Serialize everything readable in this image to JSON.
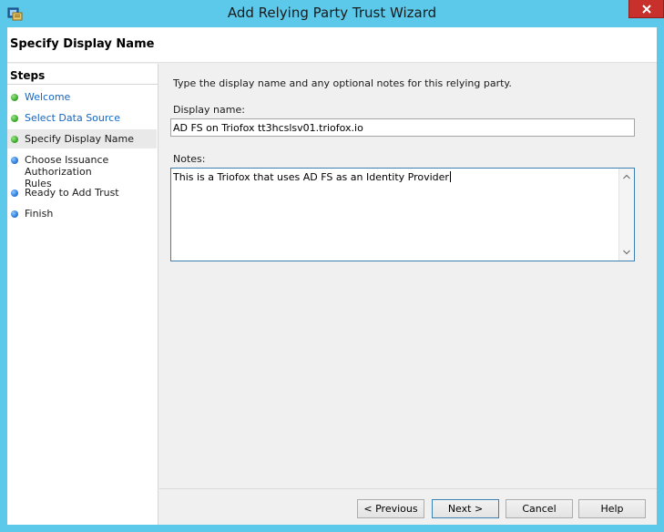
{
  "window": {
    "title": "Add Relying Party Trust Wizard",
    "icon": "adfs-wizard-icon",
    "close_icon": "close-icon",
    "accent": "#5cc8ea",
    "close_color": "#c7302b"
  },
  "header": {
    "title": "Specify Display Name"
  },
  "steps": {
    "title": "Steps",
    "items": [
      {
        "label": "Welcome",
        "status": "completed",
        "link": true
      },
      {
        "label": "Select Data Source",
        "status": "completed",
        "link": true
      },
      {
        "label": "Specify Display Name",
        "status": "current",
        "link": false
      },
      {
        "label": "Choose Issuance Authorization Rules",
        "status": "pending",
        "link": false
      },
      {
        "label": "Ready to Add Trust",
        "status": "pending",
        "link": false
      },
      {
        "label": "Finish",
        "status": "pending",
        "link": false
      }
    ],
    "colors": {
      "completed": "#2ea21e",
      "pending": "#1d6fd6",
      "link": "#1566c0"
    }
  },
  "content": {
    "instructions": "Type the display name and any optional notes for this relying party.",
    "display_name_label": "Display name:",
    "display_name_value": "AD FS on Triofox tt3hcslsv01.triofox.io",
    "notes_label": "Notes:",
    "notes_value": "This is a Triofox that uses AD FS as an Identity Provider"
  },
  "buttons": {
    "previous": "< Previous",
    "next": "Next >",
    "cancel": "Cancel",
    "help": "Help"
  }
}
